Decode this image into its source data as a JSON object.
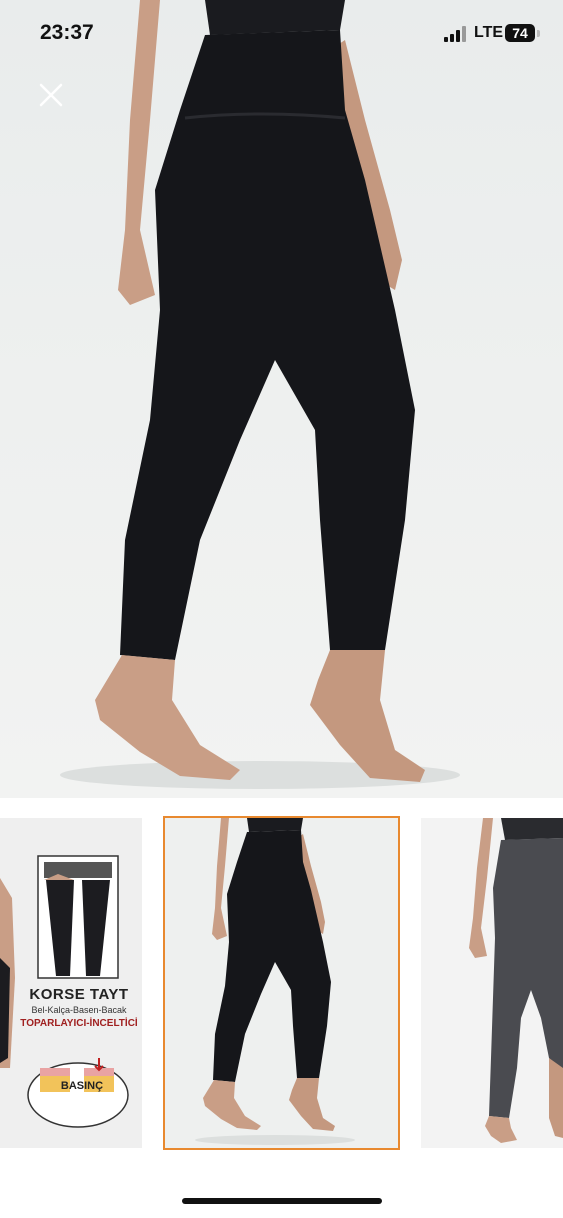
{
  "status_bar": {
    "time": "23:37",
    "network": "LTE",
    "battery": "74"
  },
  "hero": {
    "icon": "close-icon",
    "product": "black high-waist leggings"
  },
  "thumbnails": [
    {
      "title": "KORSE TAYT",
      "subtitle": "Bel-Kalça-Basen-Bacak",
      "tagline": "TOPARLAYICI-İNCELTİCİ",
      "pressure_label": "BASINÇ"
    },
    {
      "selected": true
    },
    {}
  ],
  "colors": {
    "selected_outline": "#e8892f",
    "legging": "#15161a",
    "skin": "#caa088"
  }
}
